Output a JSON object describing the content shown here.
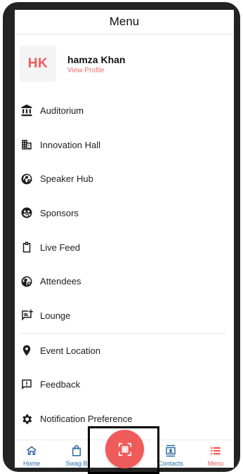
{
  "header": {
    "title": "Menu"
  },
  "profile": {
    "initials": "HK",
    "name": "hamza Khan",
    "link": "View Profile"
  },
  "menu": {
    "items": [
      {
        "label": "Auditorium",
        "icon": "auditorium-icon"
      },
      {
        "label": "Innovation Hall",
        "icon": "innovation-hall-icon"
      },
      {
        "label": "Speaker Hub",
        "icon": "speaker-hub-icon"
      },
      {
        "label": "Sponsors",
        "icon": "sponsors-icon"
      },
      {
        "label": "Live Feed",
        "icon": "clipboard-icon"
      },
      {
        "label": "Attendees",
        "icon": "attendees-icon"
      },
      {
        "label": "Lounge",
        "icon": "chat-icon"
      },
      {
        "label": "Event Location",
        "icon": "location-pin-icon"
      },
      {
        "label": "Feedback",
        "icon": "feedback-icon"
      },
      {
        "label": "Notification Preference",
        "icon": "gear-icon"
      }
    ]
  },
  "bottom_nav": {
    "items": [
      {
        "label": "Home",
        "icon": "home-icon"
      },
      {
        "label": "Swag B",
        "icon": "bag-icon"
      },
      {
        "label": "Contacts",
        "icon": "contacts-icon"
      },
      {
        "label": "Menu",
        "icon": "menu-list-icon"
      }
    ],
    "scan": {
      "icon": "qr-scan-icon"
    }
  },
  "colors": {
    "accent": "#ef5a5a",
    "nav_blue": "#2b6aa6",
    "frame": "#232323"
  }
}
